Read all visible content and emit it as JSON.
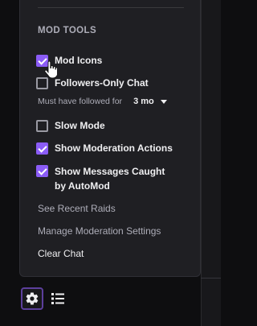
{
  "section_title": "MOD TOOLS",
  "options": [
    {
      "label": "Mod Icons",
      "checked": true
    },
    {
      "label": "Followers-Only Chat",
      "checked": false
    },
    {
      "label": "Slow Mode",
      "checked": false
    },
    {
      "label": "Show Moderation Actions",
      "checked": true
    },
    {
      "label": "Show Messages Caught by AutoMod",
      "checked": true
    }
  ],
  "followers_duration": {
    "label": "Must have followed for",
    "value": "3 mo"
  },
  "links": {
    "recent_raids": "See Recent Raids",
    "manage_settings": "Manage Moderation Settings",
    "clear_chat": "Clear Chat"
  },
  "icons": {
    "settings": "gear-icon",
    "list": "list-icon",
    "cursor": "hand-pointer-icon"
  },
  "colors": {
    "accent": "#8b5cf6",
    "panel": "#1f1f23",
    "background": "#0e0e10"
  }
}
